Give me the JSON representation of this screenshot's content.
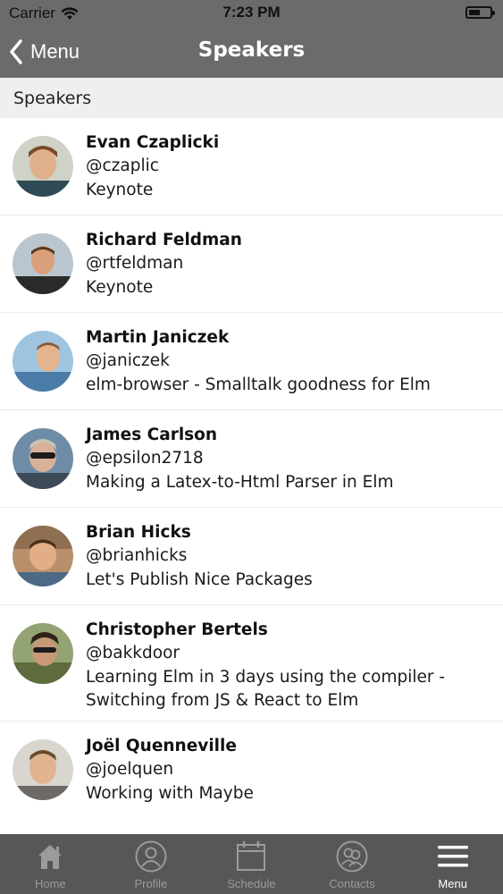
{
  "status": {
    "carrier": "Carrier",
    "time": "7:23 PM"
  },
  "nav": {
    "back_label": "Menu",
    "title": "Speakers"
  },
  "section": {
    "title": "Speakers"
  },
  "speakers": [
    {
      "name": "Evan Czaplicki",
      "handle": "@czaplic",
      "talk": "Keynote"
    },
    {
      "name": "Richard Feldman",
      "handle": "@rtfeldman",
      "talk": "Keynote"
    },
    {
      "name": "Martin Janiczek",
      "handle": "@janiczek",
      "talk": "elm-browser - Smalltalk goodness for Elm"
    },
    {
      "name": "James Carlson",
      "handle": "@epsilon2718",
      "talk": "Making a Latex-to-Html Parser in Elm"
    },
    {
      "name": "Brian Hicks",
      "handle": "@brianhicks",
      "talk": "Let's Publish Nice Packages"
    },
    {
      "name": "Christopher Bertels",
      "handle": "@bakkdoor",
      "talk": "Learning Elm in 3 days using the compiler - Switching from JS & React to Elm"
    },
    {
      "name": "Joël Quenneville",
      "handle": "@joelquen",
      "talk": "Working with Maybe"
    }
  ],
  "tabs": [
    {
      "label": "Home",
      "icon": "home-icon"
    },
    {
      "label": "Profile",
      "icon": "profile-icon"
    },
    {
      "label": "Schedule",
      "icon": "calendar-icon"
    },
    {
      "label": "Contacts",
      "icon": "contacts-icon"
    },
    {
      "label": "Menu",
      "icon": "menu-icon",
      "active": true
    }
  ],
  "colors": {
    "bar": "#6b6b6b",
    "tabbar": "#575757",
    "section_bg": "#efeff0",
    "tab_inactive": "#9b9b9b",
    "tab_active": "#ffffff"
  }
}
